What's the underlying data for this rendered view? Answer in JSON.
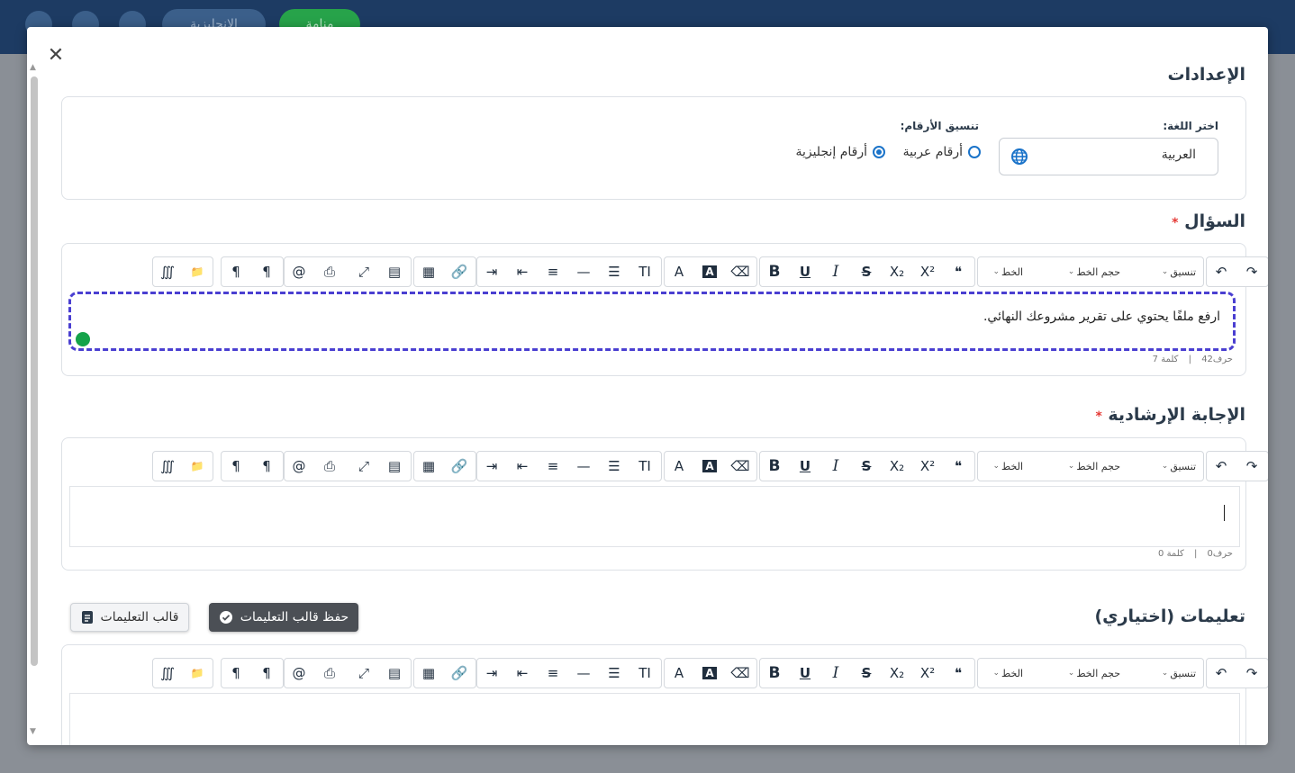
{
  "background": {
    "header_pills": [
      "الإنجليزية",
      "منامة"
    ]
  },
  "modal": {
    "settings": {
      "title": "الإعدادات",
      "language_label": "اختر اللغة:",
      "language_value": "العربية",
      "number_format_label": "تنسيق الأرقام:",
      "arabic_numbers": "أرقام عربية",
      "english_numbers": "أرقام إنجليزية",
      "selected_number_format": "english"
    },
    "toolbar": {
      "format": "تنسيق",
      "font_size": "حجم الخط",
      "font": "الخط"
    },
    "question": {
      "title": "السؤال",
      "required_mark": "*",
      "text": "ارفع ملفًا يحتوي على تقرير مشروعك النهائي.",
      "chars": "حرف42",
      "separator": "|",
      "words": "كلمة 7"
    },
    "guide_answer": {
      "title": "الإجابة الإرشادية",
      "required_mark": "*",
      "chars": "حرف0",
      "separator": "|",
      "words": "كلمة 0"
    },
    "instructions": {
      "title": "تعليمات (اختياري)",
      "save_template": "حفظ قالب التعليمات",
      "template": "قالب التعليمات"
    }
  },
  "colors": {
    "header": "#1d3b63",
    "accent": "#1a73c9",
    "focus_border": "#4a3fd1",
    "required": "#e53935"
  }
}
